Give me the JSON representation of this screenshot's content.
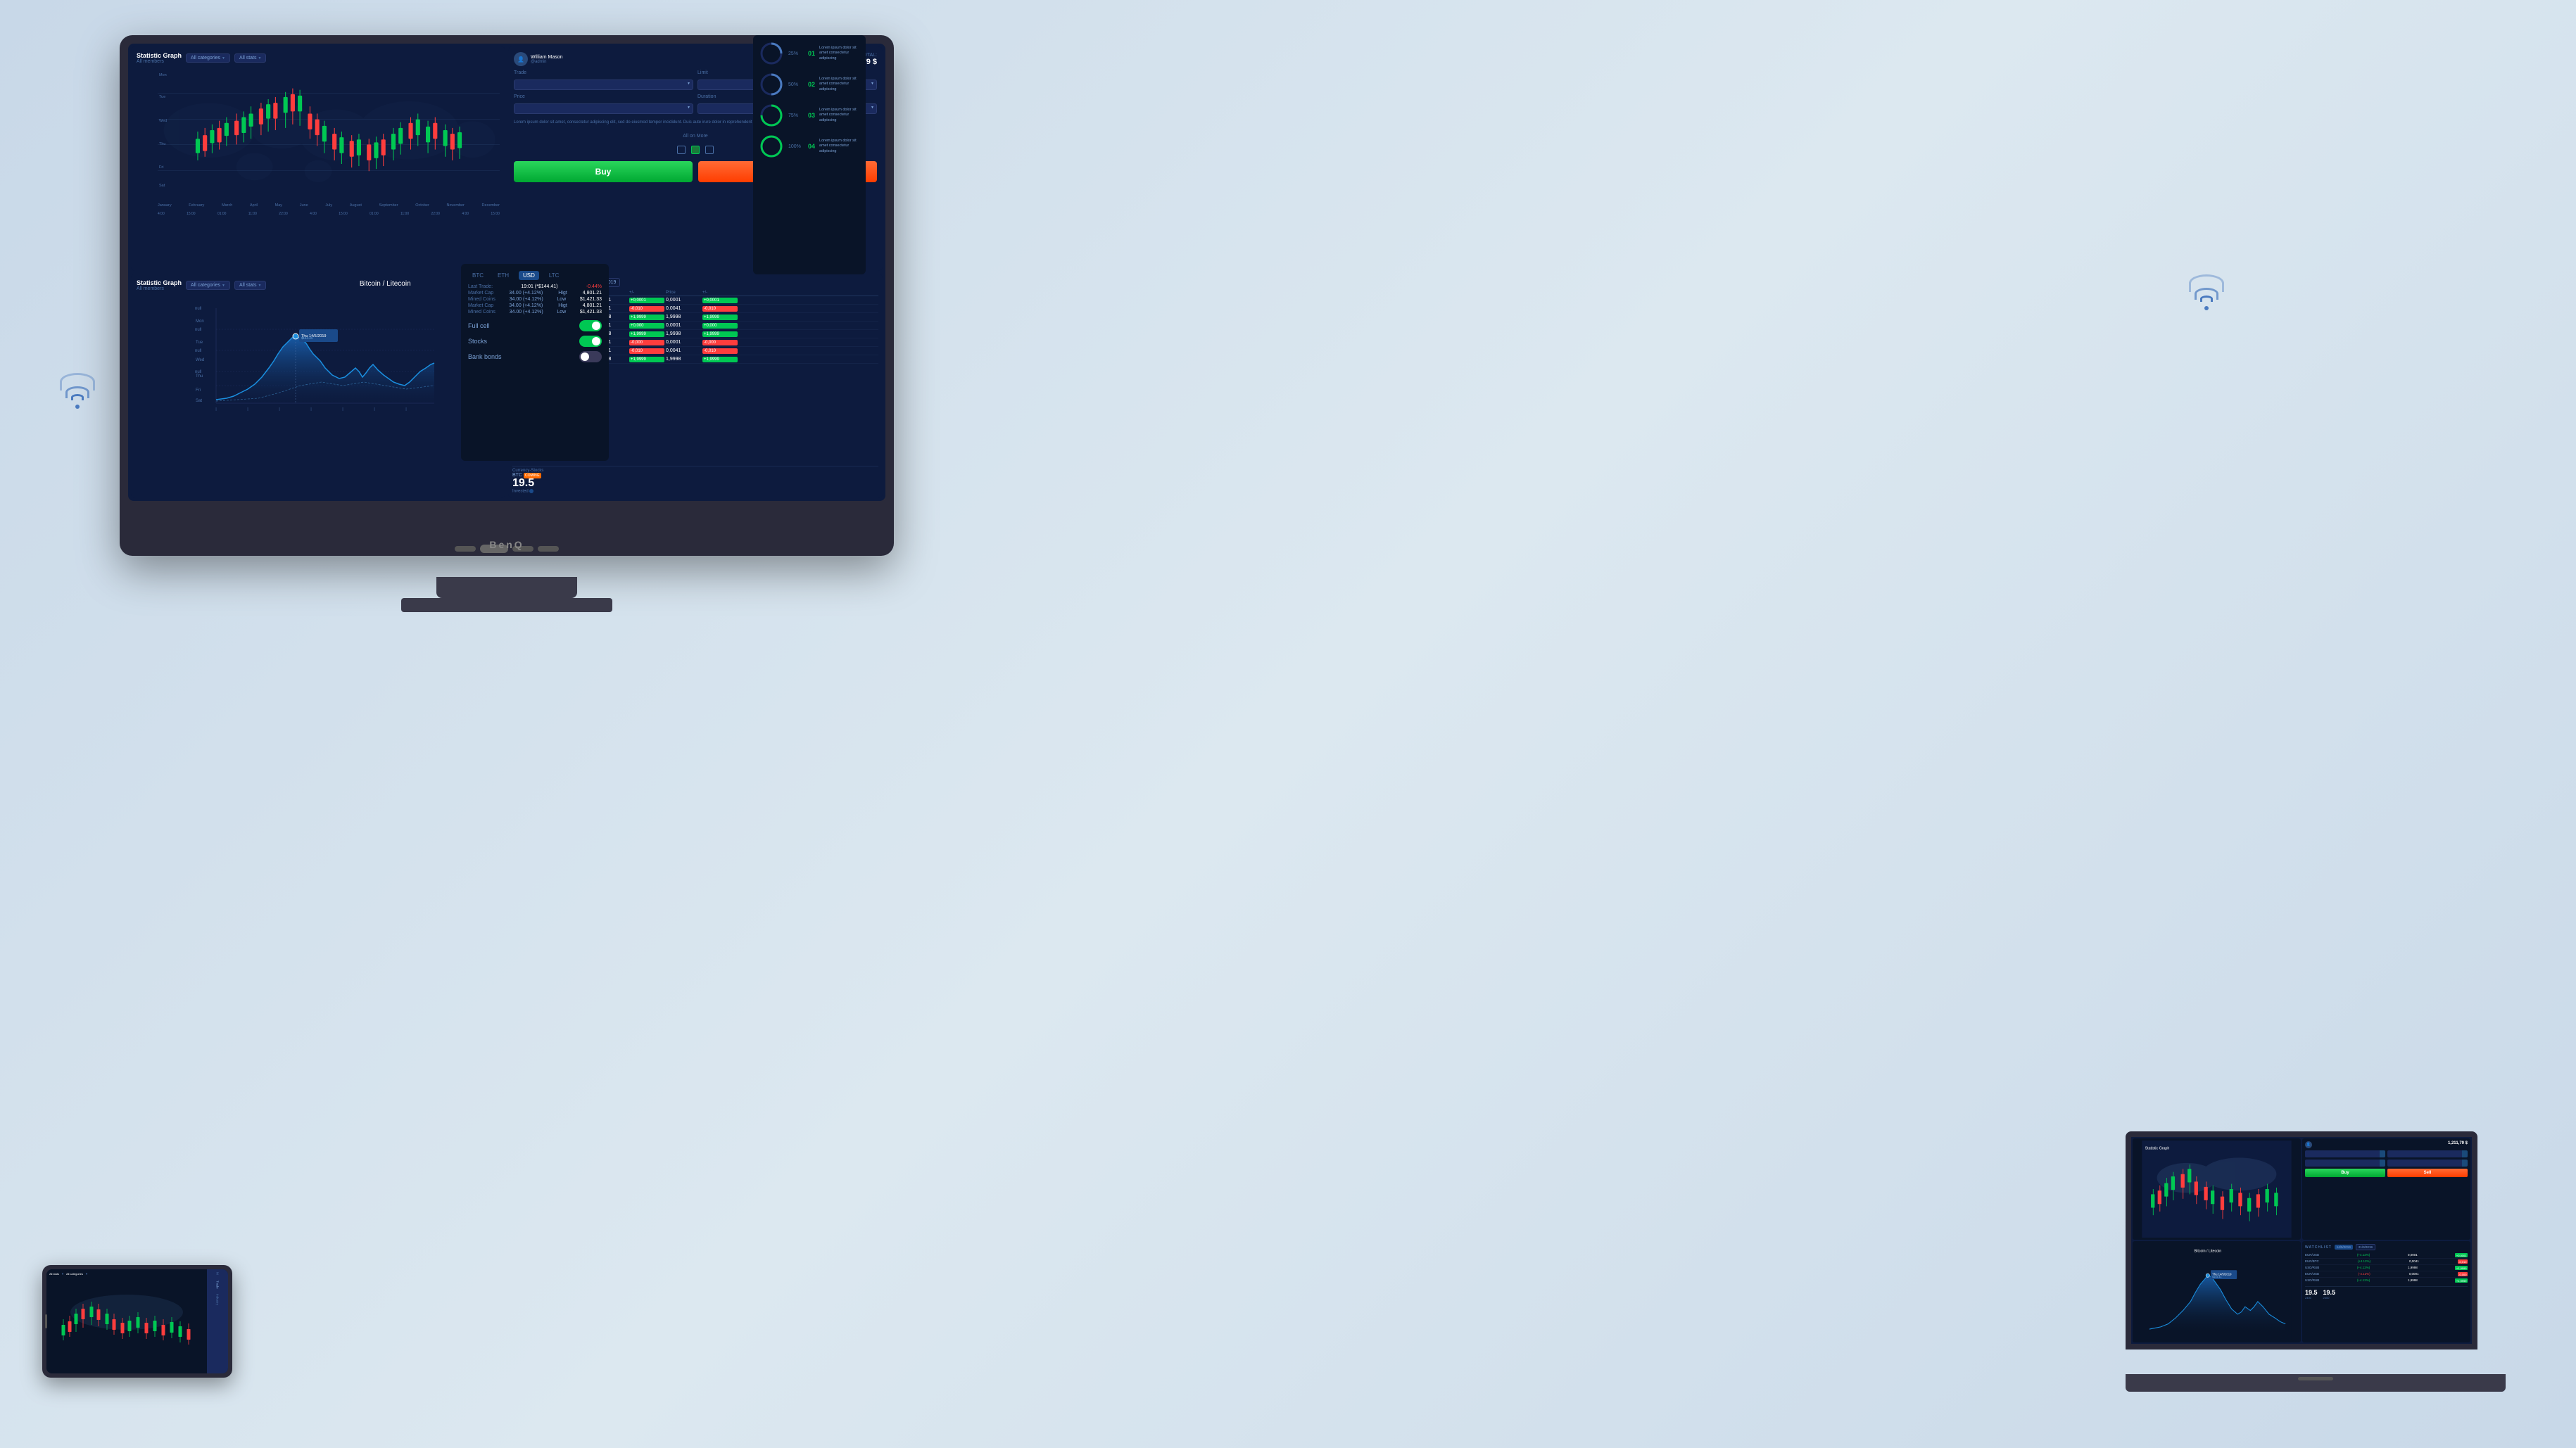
{
  "bg": {
    "color": "#c8d8e8"
  },
  "monitor": {
    "brand": "BenQ",
    "panels": {
      "topLeft": {
        "title": "Statistic Graph",
        "subtitle": "All members",
        "dropdown1": "All categories",
        "dropdown2": "All stats",
        "xLabels": [
          "January",
          "February",
          "March",
          "April",
          "May",
          "June",
          "July",
          "August",
          "September",
          "October",
          "November",
          "December"
        ],
        "yLabels": [
          "Mon",
          "Tue",
          "Wed",
          "Thu",
          "Fri",
          "Sat"
        ],
        "timeLabels": [
          "4:00",
          "15:00",
          "01:00",
          "11:00",
          "22:00",
          "4:00",
          "15:00",
          "01:00",
          "11:00",
          "22:00",
          "4:00",
          "15:00"
        ]
      },
      "topRight": {
        "title": "TOTAL:",
        "totalAmount": "1,211,79 $",
        "tradeLabel": "Trade",
        "limitLabel": "Limit",
        "priceLabel": "Price",
        "durationLabel": "Duration",
        "allOnMore": "All on More",
        "buyLabel": "Buy",
        "sellLabel": "Sell"
      },
      "farRight": {
        "items": [
          {
            "pct": "25%",
            "num": "01",
            "text": "Lorem ipsum dolor sit amet, consectetur adipiscing elit. Sed do eiusmod tempor incididunt ut labore et dolore magna aliqua."
          },
          {
            "pct": "50%",
            "num": "02",
            "text": "Lorem ipsum dolor sit amet, consectetur adipiscing elit. Sed do eiusmod tempor incididunt ut labore et dolore magna aliqua."
          },
          {
            "pct": "75%",
            "num": "03",
            "text": "Lorem ipsum dolor sit amet, consectetur adipiscing elit. Sed do eiusmod tempor incididunt ut labore et dolore magna aliqua."
          },
          {
            "pct": "100%",
            "num": "04",
            "text": "Lorem ipsum dolor sit amet, consectetur adipiscing elit. Sed do eiusmod tempor incididunt ut labore et dolore magna aliqua."
          }
        ]
      },
      "bottomLeft": {
        "title": "Statistic Graph",
        "subtitle": "All members",
        "dropdown1": "All categories",
        "dropdown2": "All stats",
        "chartTitle": "Bitcoin / Litecoin",
        "tickers": [
          "BTC",
          "ETH",
          "USD",
          "LTC"
        ],
        "activeTicker": "USD",
        "lastTrade": "19:01 (*$144.41)",
        "lastTradePct": "-0.44%",
        "marketCap": "34.00 (+4.12%)",
        "minedCoins": "34.00 (+4.12%)",
        "hight": "4,801.21",
        "low": "$1,421.33",
        "toggles": [
          {
            "label": "Full cell",
            "on": true
          },
          {
            "label": "Stocks",
            "on": true
          },
          {
            "label": "Bank bonds",
            "on": false
          }
        ],
        "currencyLabel": "Currency-Stocks",
        "currencyName": "BTC",
        "currencyValue": "19.5",
        "investedLabel": "Invested"
      },
      "bottomRight": {
        "title": "WATCHLIST",
        "date1": "14/5/2019",
        "date2": "21/3/2019",
        "rows": [
          {
            "pair": "EUR/USD",
            "pct": "+4.12%",
            "price": "0,0001",
            "badge": "+0,0001",
            "pos": true
          },
          {
            "pair": "EUR/BTC",
            "pct": "+4.12%",
            "price": "0,0041",
            "badge": "+0,010",
            "pos": true
          },
          {
            "pair": "USD/RUB",
            "pct": "+4.12%",
            "price": "1,9998",
            "badge": "+1,9999",
            "pos": true
          },
          {
            "pair": "EUR/USD",
            "pct": "+4.12%",
            "price": "0,0001",
            "badge": "+0,000",
            "pos": true
          },
          {
            "pair": "USD/RUB",
            "pct": "-4.12%",
            "price": "1,9998",
            "badge": "+1,9999",
            "pos": true
          },
          {
            "pair": "EUR/USD",
            "pct": "-4.12%",
            "price": "0,0001",
            "badge": "-0,000",
            "pos": false
          },
          {
            "pair": "EUR/BTC",
            "pct": "-4.12%",
            "price": "0,0041",
            "badge": "-0,010",
            "pos": false
          },
          {
            "pair": "USD/RUB",
            "pct": "+4.12%",
            "price": "1,9998",
            "badge": "+1,9999",
            "pos": true
          },
          {
            "pair": "EUR/USD",
            "pct": "+4.1%",
            "price": "—",
            "badge": "+0,000",
            "pos": true
          },
          {
            "pair": "USD/RUB",
            "pct": "+4.12%",
            "price": "—",
            "badge": "+1,9999",
            "pos": true
          }
        ]
      }
    }
  },
  "wifi": {
    "left": {
      "color": "#4a7abf"
    },
    "right": {
      "color": "#4a7abf"
    }
  },
  "laptop": {
    "brand": "laptop"
  },
  "phone": {
    "brand": "phone"
  }
}
